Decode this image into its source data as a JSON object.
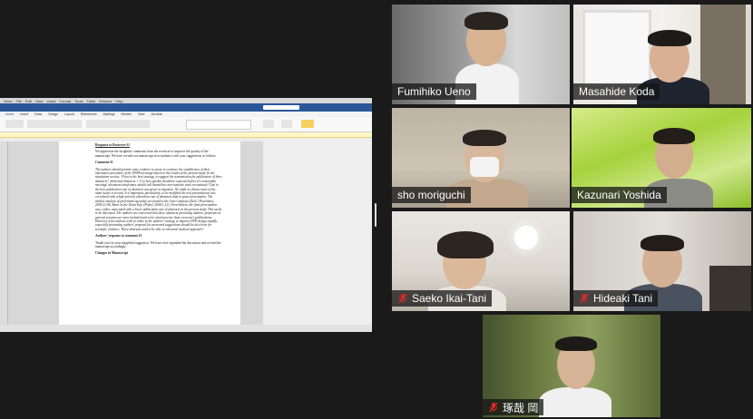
{
  "shared_screen": {
    "mac_menu": [
      "Word",
      "File",
      "Edit",
      "View",
      "Insert",
      "Format",
      "Tools",
      "Table",
      "Window",
      "Help"
    ],
    "ribbon_tabs": [
      "Home",
      "Insert",
      "Draw",
      "Design",
      "Layout",
      "References",
      "Mailings",
      "Review",
      "View",
      "Acrobat"
    ],
    "document": {
      "heading": "Response to Reviewer #1",
      "intro": "We appreciate the insightful comments from the reviewer to improve the quality of the manuscript. We have revised our manuscript in accordance with your suggestions as follows.",
      "comment_heading": "Comment #1",
      "comment_body": "The authors should provide some evidence to prove to convince the suitableness of their alternative procedure of the FEPR meetings based on the results of the present study. In the simulation section, “Four is the best strategy, to suggest the transmission for publication of three abstracts” (inherited abstracts = 3) is how quickly should be expected before it's reasonably meetings’ document timeframes should call themselves non-neutrals ratio reconstitute? Due to the how publication rate of abstracts was given in Japanese. We make to choose some of the main issues to record. It is important, particularly, to be modified the real presentations was correlated with a high-priority allocation rate of abstracts than in great presentation. The similar analysis of preferment specialty are found in the closer analysis (Zeek J Psychiatry, 2005;21:86, Basic Scene Zoom Exp. (Psthe), 2008;1:12). Nevertheless, the final presentation was, rather, associated with a lower publication rate of abstracts in the present study. This needs to be discussed. The authors are concerned that these abstracts presenting authors’ proposals in general sessions are more included and to be ruled practice than everyone's publications. However, if the authors wish to relate to the authors’ strategy to improve HVP-design rapidly, especially promoting authors’ proposal for presented suggestions should be also been for scientific evidence. These abstracts tend to be able to rehearsal medical approach?",
      "response_heading": "Authors' response to comment #1",
      "response_body": "Thank you for your insightful suggestion. We have now expanded the discussion and revised the manuscript accordingly.",
      "changes_heading": "Changes in Manuscript"
    }
  },
  "participants": [
    {
      "name": "Fumihiko Ueno",
      "muted": false,
      "active": false
    },
    {
      "name": "Masahide Koda",
      "muted": false,
      "active": false
    },
    {
      "name": "sho moriguchi",
      "muted": false,
      "active": false
    },
    {
      "name": "Kazunari Yoshida",
      "muted": false,
      "active": true
    },
    {
      "name": "Saeko Ikai-Tani",
      "muted": true,
      "active": false
    },
    {
      "name": "Hideaki Tani",
      "muted": true,
      "active": false
    },
    {
      "name": "琢哉 岡",
      "muted": true,
      "active": false
    }
  ],
  "colors": {
    "active_speaker": "#b4d800",
    "mute_icon": "#e02828",
    "word_blue": "#2b579a"
  }
}
